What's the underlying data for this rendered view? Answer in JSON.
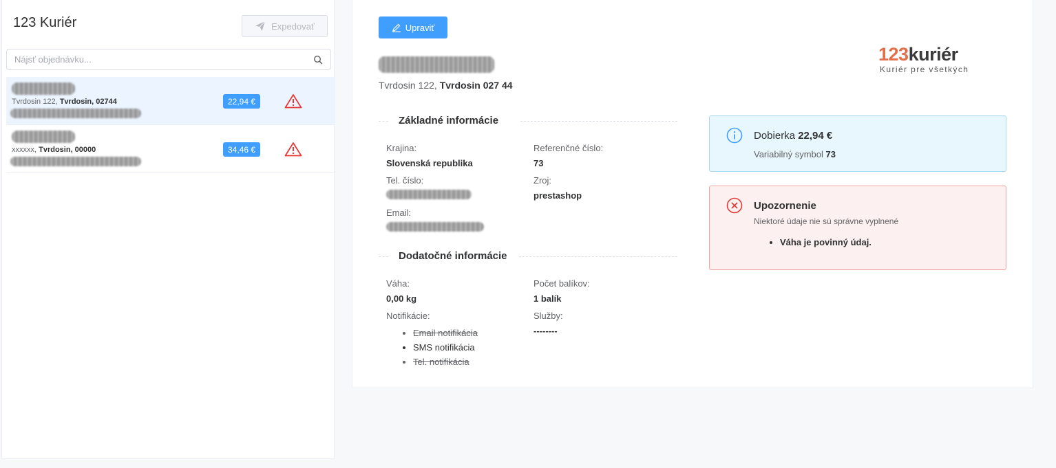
{
  "sidebar": {
    "title": "123 Kuriér",
    "expedite_label": "Expedovať",
    "search_placeholder": "Nájsť objednávku...",
    "orders": [
      {
        "addr_street": "Tvrdosin 122, ",
        "addr_city": "Tvrdosin, 02744",
        "price": "22,94 €",
        "active": true
      },
      {
        "addr_street": "xxxxxx, ",
        "addr_city": "Tvrdosin, 00000",
        "price": "34,46 €",
        "active": false
      }
    ]
  },
  "detail": {
    "edit_label": "Upraviť",
    "address_street": "Tvrdosin 122, ",
    "address_city": "Tvrdosin 027 44",
    "logo": {
      "number": "123",
      "word": "kuriér",
      "tagline": "Kuriér pre všetkých"
    },
    "basic_section": "Základné informácie",
    "country_label": "Krajina:",
    "country_value": "Slovenská republika",
    "ref_label": "Referenčné číslo:",
    "ref_value": "73",
    "phone_label": "Tel. číslo:",
    "source_label": "Zroj:",
    "source_value": "prestashop",
    "email_label": "Email:",
    "extra_section": "Dodatočné informácie",
    "weight_label": "Váha:",
    "weight_value": "0,00 kg",
    "packages_label": "Počet balíkov:",
    "packages_value": "1 balík",
    "notif_label": "Notifikácie:",
    "services_label": "Služby:",
    "services_value": "--------",
    "notifications": [
      {
        "label": "Email notifikácia",
        "enabled": false
      },
      {
        "label": "SMS notifikácia",
        "enabled": true
      },
      {
        "label": "Tel. notifikácia",
        "enabled": false
      }
    ]
  },
  "cod_alert": {
    "title_prefix": "Dobierka ",
    "amount": "22,94 €",
    "vs_label": "Variabilný symbol ",
    "vs_value": "73"
  },
  "warning_alert": {
    "title": "Upozornenie",
    "subtitle": "Niektoré údaje nie sú správne vyplnené",
    "items": [
      "Váha je povinný údaj."
    ]
  },
  "colors": {
    "primary": "#409eff",
    "danger": "#e53935",
    "logo_accent": "#e1704a"
  }
}
